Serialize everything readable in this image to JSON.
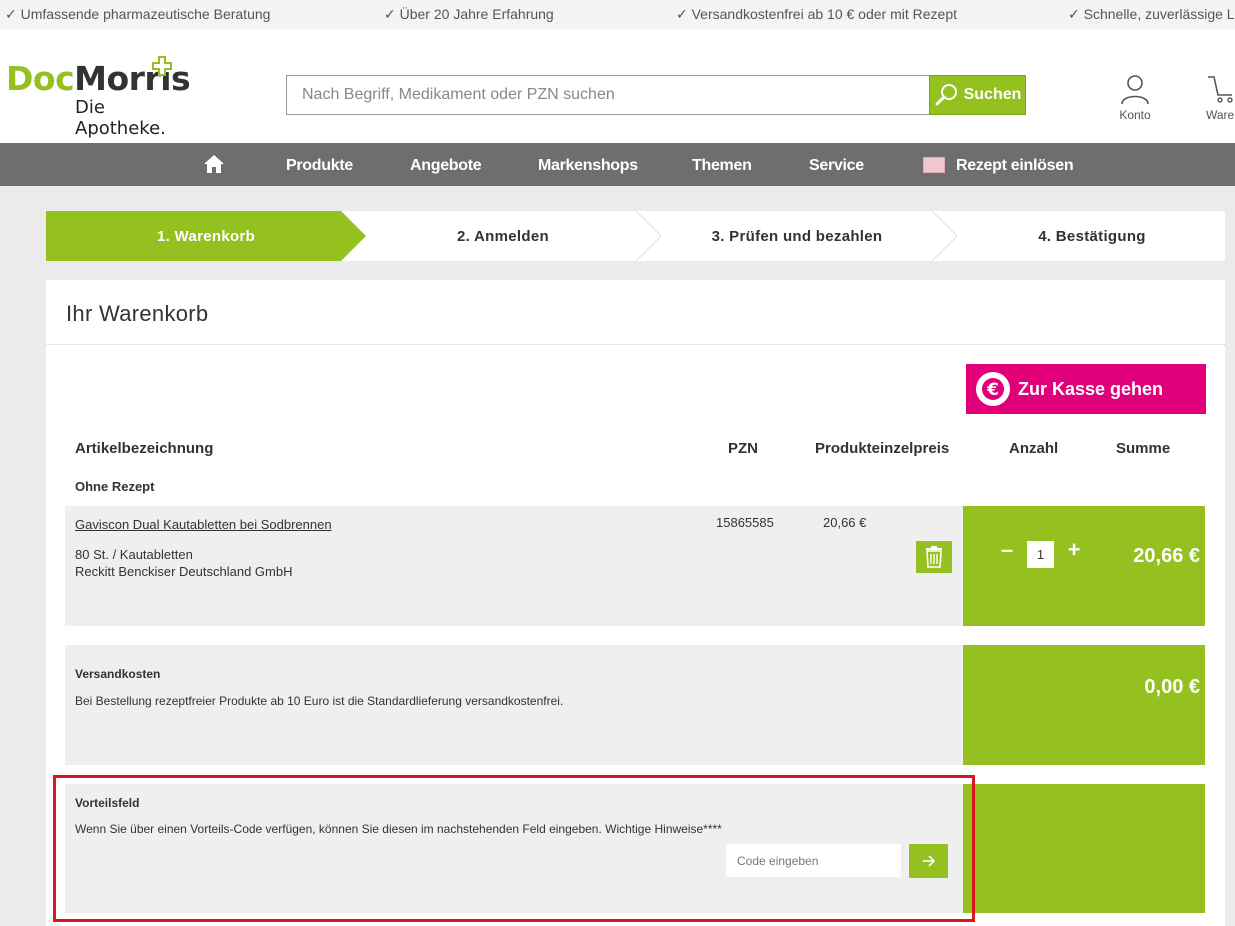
{
  "usp": [
    "✓ Umfassende pharmazeutische Beratung",
    "✓ Über 20 Jahre Erfahrung",
    "✓ Versandkostenfrei ab 10 € oder mit Rezept",
    "✓ Schnelle, zuverlässige Liefe"
  ],
  "logo": {
    "doc": "Doc",
    "morris": "Morris",
    "sub": "Die Apotheke."
  },
  "search": {
    "placeholder": "Nach Begriff, Medikament oder PZN suchen",
    "button": "Suchen"
  },
  "header_links": {
    "account": "Konto",
    "cart": "Ware"
  },
  "nav": {
    "items": [
      "Produkte",
      "Angebote",
      "Markenshops",
      "Themen",
      "Service",
      "Rezept einlösen"
    ]
  },
  "steps": [
    "1. Warenkorb",
    "2. Anmelden",
    "3. Prüfen und bezahlen",
    "4. Bestätigung"
  ],
  "cart": {
    "title": "Ihr Warenkorb",
    "checkout": "Zur Kasse gehen",
    "columns": {
      "article": "Artikelbezeichnung",
      "pzn": "PZN",
      "unit_price": "Produkteinzelpreis",
      "qty": "Anzahl",
      "sum": "Summe"
    },
    "section": "Ohne Rezept",
    "product": {
      "name": "Gaviscon Dual Kautabletten bei Sodbrennen",
      "pack": "80 St. / Kautabletten",
      "maker": "Reckitt Benckiser Deutschland GmbH",
      "pzn": "15865585",
      "unit_price": "20,66 €",
      "qty": "1",
      "minus": "–",
      "plus": "+",
      "sum": "20,66 €"
    },
    "shipping": {
      "title": "Versandkosten",
      "text": "Bei Bestellung rezeptfreier Produkte ab 10 Euro ist die Standardlieferung versandkostenfrei.",
      "sum": "0,00 €"
    },
    "voucher": {
      "title": "Vorteilsfeld",
      "text": "Wenn Sie über einen Vorteils-Code verfügen, können Sie diesen im nachstehenden Feld eingeben. Wichtige Hinweise****",
      "placeholder": "Code eingeben"
    }
  },
  "colors": {
    "brand_green": "#94c11f",
    "checkout_magenta": "#e2007a",
    "nav_gray": "#6e6e6e",
    "highlight_red": "#e0141e"
  }
}
